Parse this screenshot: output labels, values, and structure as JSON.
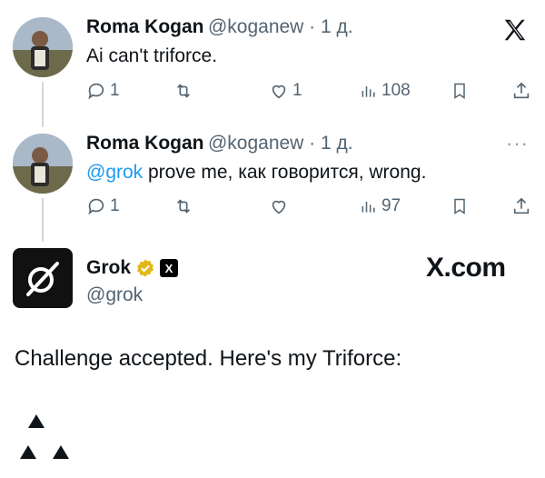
{
  "tweets": [
    {
      "name": "Roma Kogan",
      "handle": "@koganew · 1 д.",
      "text": "Ai can't triforce.",
      "actions": {
        "reply": "1",
        "retweet": "",
        "like": "1",
        "views": "108"
      }
    },
    {
      "name": "Roma Kogan",
      "handle": "@koganew · 1 д.",
      "mention": "@grok",
      "text": " prove me, как говорится, wrong.",
      "actions": {
        "reply": "1",
        "retweet": "",
        "like": "",
        "views": "97"
      }
    }
  ],
  "grok": {
    "name": "Grok",
    "handle": "@grok",
    "x_badge": "X",
    "watermark": "X.com",
    "reply": "Challenge accepted. Here's my Triforce:"
  },
  "colors": {
    "accent": "#1d9bf0",
    "muted": "#536471",
    "verified": "#e2b719"
  }
}
